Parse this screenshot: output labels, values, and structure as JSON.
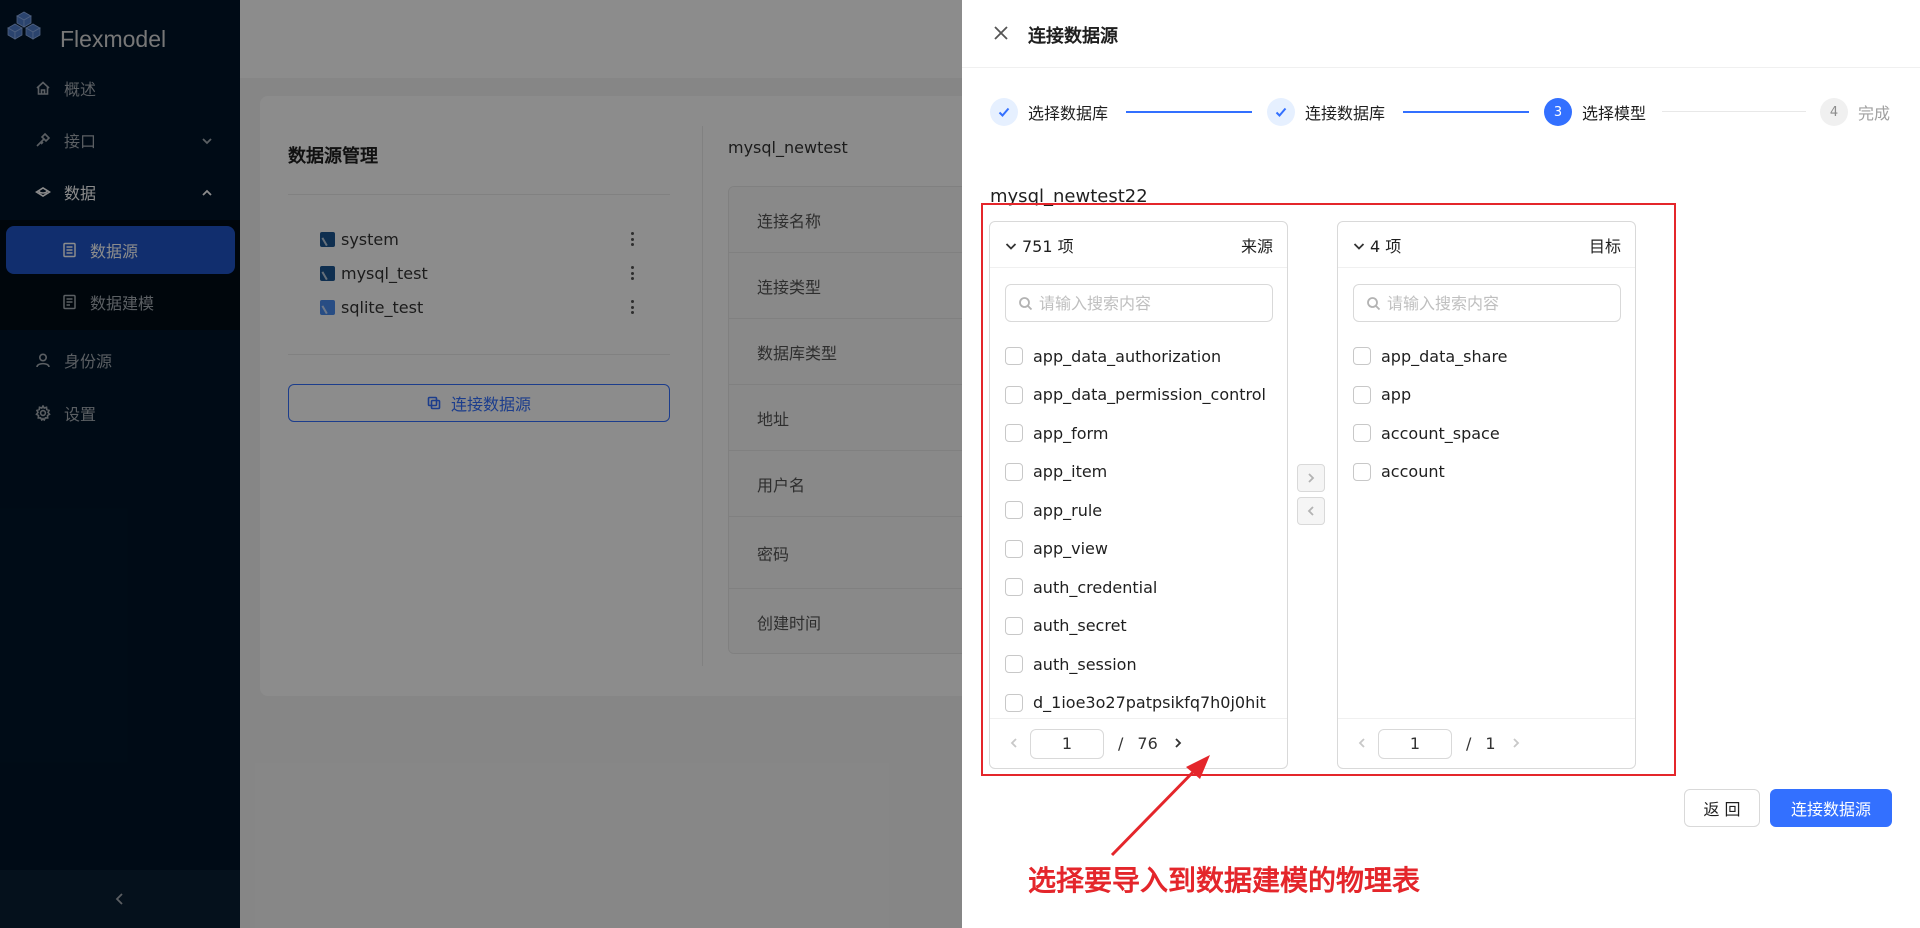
{
  "app": {
    "brand": "Flexmodel",
    "nav": {
      "overview": "概述",
      "api": "接口",
      "data": "数据",
      "datasource": "数据源",
      "data_modeling": "数据建模",
      "identity": "身份源",
      "settings": "设置"
    }
  },
  "page": {
    "title": "数据源管理",
    "datasources": [
      {
        "name": "system",
        "icon": "mysql-icon"
      },
      {
        "name": "mysql_test",
        "icon": "mysql-icon"
      },
      {
        "name": "sqlite_test",
        "icon": "sqlite-icon"
      }
    ],
    "connect_button": "连接数据源",
    "detail": {
      "title": "mysql_newtest",
      "rows": [
        "连接名称",
        "连接类型",
        "数据库类型",
        "地址",
        "用户名",
        "密码",
        "创建时间"
      ]
    }
  },
  "drawer": {
    "title": "连接数据源",
    "steps": [
      {
        "label": "选择数据库",
        "status": "done"
      },
      {
        "label": "连接数据库",
        "status": "done"
      },
      {
        "label": "选择模型",
        "status": "current",
        "number": "3"
      },
      {
        "label": "完成",
        "status": "wait",
        "number": "4"
      }
    ],
    "db_name": "mysql_newtest22",
    "source": {
      "count": "751 项",
      "title": "来源",
      "placeholder": "请输入搜索内容",
      "items": [
        "app_data_authorization",
        "app_data_permission_control",
        "app_form",
        "app_item",
        "app_rule",
        "app_view",
        "auth_credential",
        "auth_secret",
        "auth_session",
        "d_1ioe3o27patpsikfq7h0j0hit"
      ],
      "page": "1",
      "slash": "/",
      "total_pages": "76"
    },
    "target": {
      "count": "4 项",
      "title": "目标",
      "placeholder": "请输入搜索内容",
      "items": [
        "app_data_share",
        "app",
        "account_space",
        "account"
      ],
      "page": "1",
      "slash": "/",
      "total_pages": "1"
    },
    "back_button": "返 回",
    "connect_button": "连接数据源"
  },
  "annotation": {
    "text": "选择要导入到数据建模的物理表",
    "color": "#e4262b"
  },
  "colors": {
    "primary": "#3370ff",
    "sidebar_bg": "#001529",
    "active_menu": "#1f55c9"
  }
}
